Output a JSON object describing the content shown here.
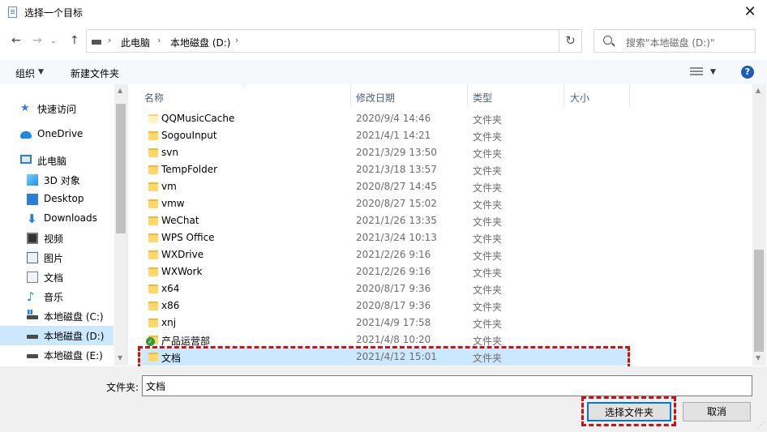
{
  "window": {
    "title": "选择一个目标",
    "close": "✕"
  },
  "nav_buttons": {
    "back": "←",
    "forward": "→",
    "dropdown": "⌄",
    "up": "↑",
    "refresh": "↻"
  },
  "address": {
    "crumbs": [
      "此电脑",
      "本地磁盘 (D:)"
    ],
    "separator": "›"
  },
  "search": {
    "placeholder": "搜索\"本地磁盘 (D:)\""
  },
  "toolbar": {
    "organize": "组织",
    "new_folder": "新建文件夹",
    "help": "?"
  },
  "sidebar": {
    "items": [
      {
        "label": "快速访问",
        "icon": "quick-access-star-icon"
      },
      {
        "label": "OneDrive",
        "icon": "onedrive-cloud-icon"
      },
      {
        "label": "此电脑",
        "icon": "this-pc-icon"
      },
      {
        "label": "3D 对象",
        "icon": "3d-objects-icon"
      },
      {
        "label": "Desktop",
        "icon": "desktop-icon"
      },
      {
        "label": "Downloads",
        "icon": "downloads-icon"
      },
      {
        "label": "视频",
        "icon": "videos-icon"
      },
      {
        "label": "图片",
        "icon": "pictures-icon"
      },
      {
        "label": "文档",
        "icon": "documents-icon"
      },
      {
        "label": "音乐",
        "icon": "music-icon"
      },
      {
        "label": "本地磁盘 (C:)",
        "icon": "system-drive-icon"
      },
      {
        "label": "本地磁盘 (D:)",
        "icon": "drive-icon",
        "selected": true
      },
      {
        "label": "本地磁盘 (E:)",
        "icon": "drive-icon"
      }
    ]
  },
  "columns": {
    "name": "名称",
    "modified": "修改日期",
    "type": "类型",
    "size": "大小"
  },
  "files": [
    {
      "name": "QQMusicCache",
      "modified": "2020/9/4 14:46",
      "type": "文件夹"
    },
    {
      "name": "SogouInput",
      "modified": "2021/4/1 14:21",
      "type": "文件夹"
    },
    {
      "name": "svn",
      "modified": "2021/3/29 13:50",
      "type": "文件夹"
    },
    {
      "name": "TempFolder",
      "modified": "2021/3/18 13:57",
      "type": "文件夹"
    },
    {
      "name": "vm",
      "modified": "2020/8/27 14:45",
      "type": "文件夹"
    },
    {
      "name": "vmw",
      "modified": "2020/8/27 15:02",
      "type": "文件夹"
    },
    {
      "name": "WeChat",
      "modified": "2021/1/26 13:35",
      "type": "文件夹"
    },
    {
      "name": "WPS Office",
      "modified": "2021/3/24 10:13",
      "type": "文件夹"
    },
    {
      "name": "WXDrive",
      "modified": "2021/2/26 9:16",
      "type": "文件夹"
    },
    {
      "name": "WXWork",
      "modified": "2021/2/26 9:16",
      "type": "文件夹"
    },
    {
      "name": "x64",
      "modified": "2020/8/17 9:36",
      "type": "文件夹"
    },
    {
      "name": "x86",
      "modified": "2020/8/17 9:36",
      "type": "文件夹"
    },
    {
      "name": "xnj",
      "modified": "2021/4/9 17:58",
      "type": "文件夹"
    },
    {
      "name": "产品运营部",
      "modified": "2021/4/8 10:20",
      "type": "文件夹"
    },
    {
      "name": "文档",
      "modified": "2021/4/12 15:01",
      "type": "文件夹",
      "selected": true
    }
  ],
  "footer": {
    "folder_label": "文件夹:",
    "folder_value": "文档",
    "select_button": "选择文件夹",
    "cancel_button": "取消"
  },
  "colors": {
    "selection": "#cce8ff",
    "highlight_dash": "#d40f0f",
    "accent": "#0078d7"
  }
}
